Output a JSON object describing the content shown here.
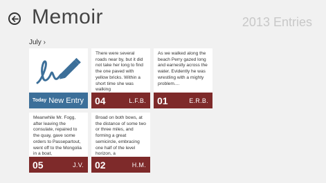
{
  "header": {
    "back_icon": "arrow-left-circle-icon",
    "title": "Memoir",
    "entries_count": "2013 Entries"
  },
  "section": {
    "month_label": "July",
    "chevron_icon": "chevron-right-icon"
  },
  "tiles": [
    {
      "type": "new",
      "icon": "signature-pen-icon",
      "today_label": "Today",
      "label": "New Entry",
      "bar_color": "#3c6f99"
    },
    {
      "type": "entry",
      "text": "There were several roads near by, but it did not take her long to find the one paved with yellow bricks. Within a short time she was walking",
      "day": "04",
      "author": "L.F.B.",
      "bar_color": "#7e2a2a"
    },
    {
      "type": "entry",
      "text": "As we  walked along the beach  Perry gazed long and earnestly across the water.  Evidently he was wrestling  with a mighty problem....",
      "day": "01",
      "author": "E.R.B.",
      "bar_color": "#7e2a2a"
    },
    {
      "type": "entry",
      "text": "Meanwhile Mr. Fogg, after leaving the consulate, repaired to the quay,  gave some orders to Passepartout, went off to the    Mongolia in a boat,",
      "day": "05",
      "author": "J.V.",
      "bar_color": "#7e2a2a"
    },
    {
      "type": "entry",
      "text": "Broad on both bows, at the distance of some two or three miles, and  forming a great semicircle, embracing one half of the level horizon, a",
      "day": "02",
      "author": "H.M.",
      "bar_color": "#7e2a2a"
    }
  ]
}
